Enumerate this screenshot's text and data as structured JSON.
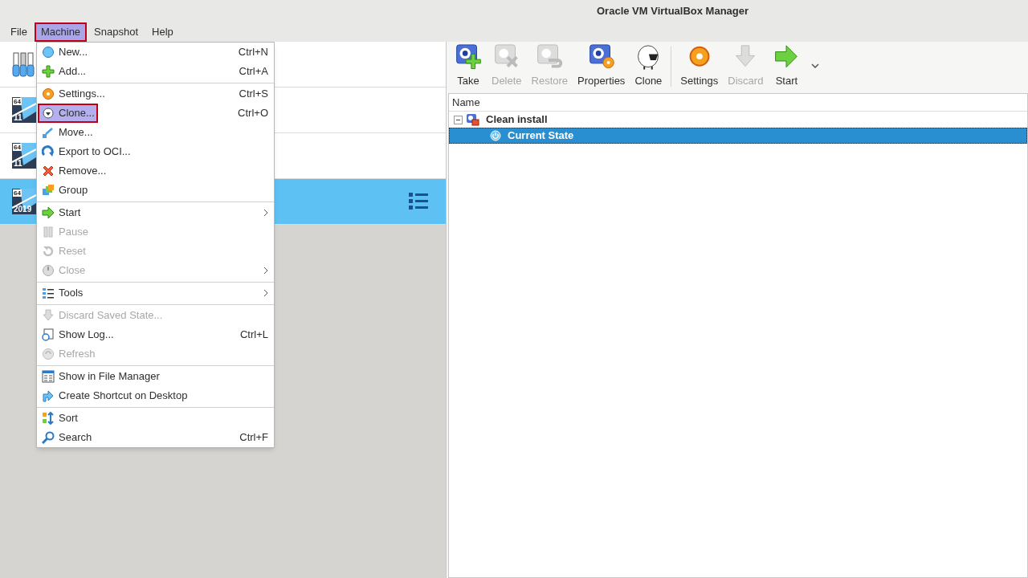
{
  "window": {
    "title": "Oracle VM VirtualBox Manager"
  },
  "menubar": [
    {
      "label": "File",
      "selected": false,
      "annotated": false
    },
    {
      "label": "Machine",
      "selected": true,
      "annotated": true
    },
    {
      "label": "Snapshot",
      "selected": false,
      "annotated": false
    },
    {
      "label": "Help",
      "selected": false,
      "annotated": false
    }
  ],
  "vm_list": [
    {
      "kind": "tools",
      "selected": false
    },
    {
      "kind": "vm",
      "badge_bits": "64",
      "badge_version": "11",
      "selected": false
    },
    {
      "kind": "vm",
      "badge_bits": "64",
      "badge_version": "11",
      "selected": false
    },
    {
      "kind": "vm",
      "badge_bits": "64",
      "badge_version": "2019",
      "selected": true
    }
  ],
  "machine_menu": [
    {
      "kind": "item",
      "label": "New...",
      "shortcut": "Ctrl+N",
      "disabled": false,
      "submenu": false,
      "selected": false,
      "annotated": false
    },
    {
      "kind": "item",
      "label": "Add...",
      "shortcut": "Ctrl+A",
      "disabled": false,
      "submenu": false,
      "selected": false,
      "annotated": false
    },
    {
      "kind": "separator"
    },
    {
      "kind": "item",
      "label": "Settings...",
      "shortcut": "Ctrl+S",
      "disabled": false,
      "submenu": false,
      "selected": false,
      "annotated": false
    },
    {
      "kind": "item",
      "label": "Clone...",
      "shortcut": "Ctrl+O",
      "disabled": false,
      "submenu": false,
      "selected": true,
      "annotated": true
    },
    {
      "kind": "item",
      "label": "Move...",
      "disabled": false,
      "submenu": false,
      "selected": false,
      "annotated": false
    },
    {
      "kind": "item",
      "label": "Export to OCI...",
      "disabled": false,
      "submenu": false,
      "selected": false,
      "annotated": false
    },
    {
      "kind": "item",
      "label": "Remove...",
      "disabled": false,
      "submenu": false,
      "selected": false,
      "annotated": false
    },
    {
      "kind": "item",
      "label": "Group",
      "disabled": false,
      "submenu": false,
      "selected": false,
      "annotated": false
    },
    {
      "kind": "separator"
    },
    {
      "kind": "item",
      "label": "Start",
      "disabled": false,
      "submenu": true,
      "selected": false,
      "annotated": false
    },
    {
      "kind": "item",
      "label": "Pause",
      "disabled": true,
      "submenu": false,
      "selected": false,
      "annotated": false
    },
    {
      "kind": "item",
      "label": "Reset",
      "disabled": true,
      "submenu": false,
      "selected": false,
      "annotated": false
    },
    {
      "kind": "item",
      "label": "Close",
      "disabled": true,
      "submenu": true,
      "selected": false,
      "annotated": false
    },
    {
      "kind": "separator"
    },
    {
      "kind": "item",
      "label": "Tools",
      "disabled": false,
      "submenu": true,
      "selected": false,
      "annotated": false
    },
    {
      "kind": "separator"
    },
    {
      "kind": "item",
      "label": "Discard Saved State...",
      "disabled": true,
      "submenu": false,
      "selected": false,
      "annotated": false
    },
    {
      "kind": "item",
      "label": "Show Log...",
      "shortcut": "Ctrl+L",
      "disabled": false,
      "submenu": false,
      "selected": false,
      "annotated": false
    },
    {
      "kind": "item",
      "label": "Refresh",
      "disabled": true,
      "submenu": false,
      "selected": false,
      "annotated": false
    },
    {
      "kind": "separator"
    },
    {
      "kind": "item",
      "label": "Show in File Manager",
      "disabled": false,
      "submenu": false,
      "selected": false,
      "annotated": false
    },
    {
      "kind": "item",
      "label": "Create Shortcut on Desktop",
      "disabled": false,
      "submenu": false,
      "selected": false,
      "annotated": false
    },
    {
      "kind": "separator"
    },
    {
      "kind": "item",
      "label": "Sort",
      "disabled": false,
      "submenu": false,
      "selected": false,
      "annotated": false
    },
    {
      "kind": "item",
      "label": "Search",
      "shortcut": "Ctrl+F",
      "disabled": false,
      "submenu": false,
      "selected": false,
      "annotated": false
    }
  ],
  "toolbar": [
    {
      "kind": "button",
      "label": "Take",
      "disabled": false
    },
    {
      "kind": "button",
      "label": "Delete",
      "disabled": true
    },
    {
      "kind": "button",
      "label": "Restore",
      "disabled": true
    },
    {
      "kind": "button",
      "label": "Properties",
      "disabled": false
    },
    {
      "kind": "button",
      "label": "Clone",
      "disabled": false
    },
    {
      "kind": "separator"
    },
    {
      "kind": "button",
      "label": "Settings",
      "disabled": false
    },
    {
      "kind": "button",
      "label": "Discard",
      "disabled": true
    },
    {
      "kind": "button",
      "label": "Start",
      "disabled": false
    },
    {
      "kind": "more"
    }
  ],
  "snapshot_tree": {
    "columns": [
      "Name"
    ],
    "nodes": [
      {
        "label": "Clean install",
        "expanded": true,
        "selected": false,
        "children": [
          {
            "label": "Current State",
            "selected": true
          }
        ]
      }
    ]
  }
}
